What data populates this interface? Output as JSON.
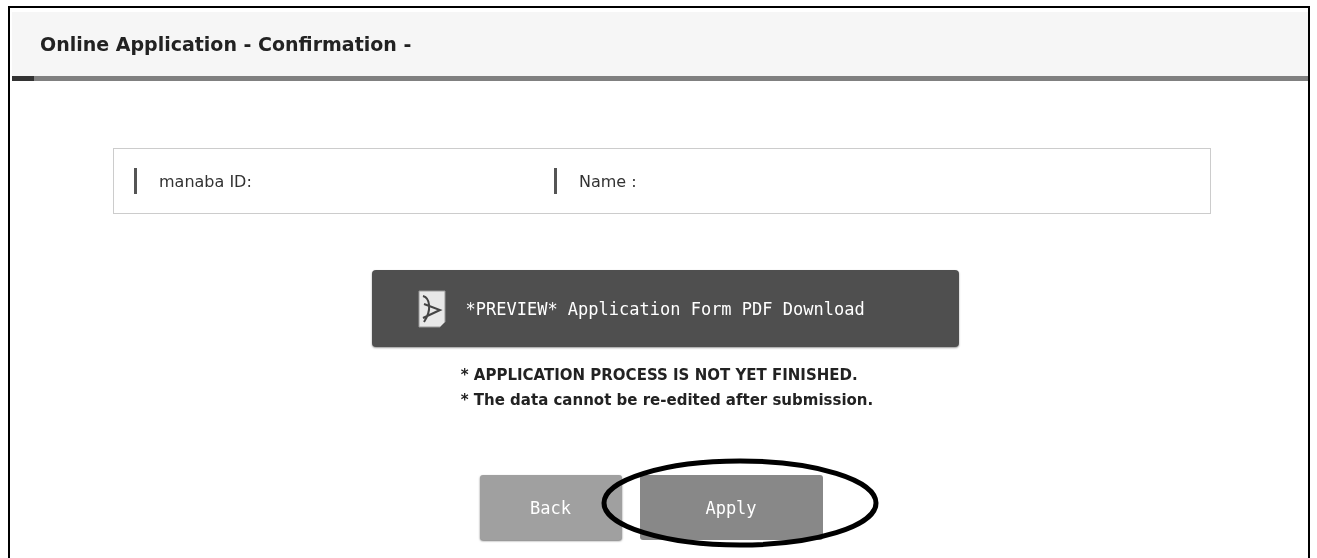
{
  "header": {
    "title": "Online Application - Confirmation -"
  },
  "info": [
    {
      "label": "manaba ID:"
    },
    {
      "label": "Name :"
    }
  ],
  "pdf_button": {
    "label": "*PREVIEW* Application Form PDF Download"
  },
  "notes": [
    "* APPLICATION PROCESS IS NOT YET FINISHED.",
    "* The data cannot be re-edited after submission."
  ],
  "buttons": [
    {
      "label": "Back",
      "kind": "back",
      "highlighted": false
    },
    {
      "label": "Apply",
      "kind": "apply",
      "highlighted": true
    }
  ]
}
